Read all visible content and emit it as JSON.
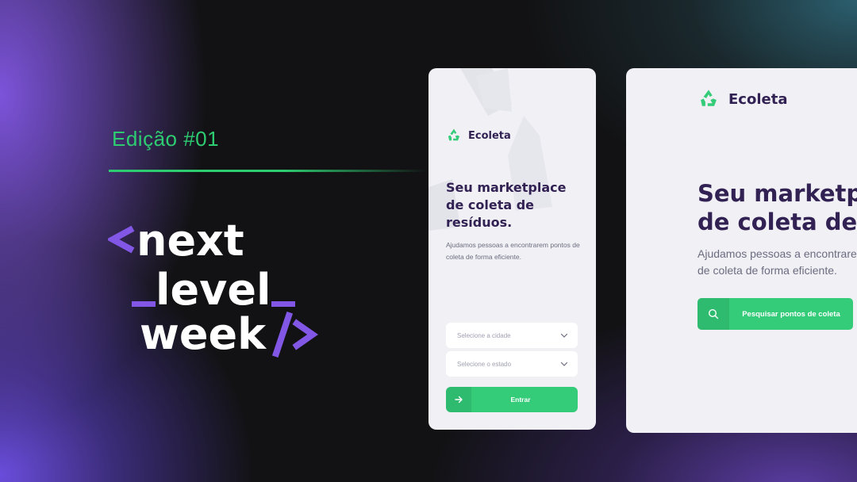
{
  "colors": {
    "background": "#121214",
    "accent_green": "#34cb79",
    "edition_green": "#2ecc71",
    "brand_purple": "#8257e5",
    "title_color": "#322153",
    "text_muted": "#6c6c80",
    "card_bg": "#f0f0f5"
  },
  "event": {
    "edition": "Edição #01",
    "logo_lines": [
      "<next",
      "_level_",
      "week/>"
    ]
  },
  "mobile": {
    "logo_icon": "recycle-icon",
    "logo_text": "Ecoleta",
    "title": "Seu marketplace de coleta de resíduos.",
    "description": "Ajudamos pessoas a encontrarem pontos de coleta de forma eficiente.",
    "city_select": "Selecione a cidade",
    "state_select": "Selecione o estado",
    "button_icon": "arrow-right-icon",
    "button_label": "Entrar"
  },
  "desktop": {
    "logo_icon": "recycle-icon",
    "logo_text": "Ecoleta",
    "title_line1": "Seu marketplace",
    "title_line2": "de coleta de resíduos.",
    "description_line1": "Ajudamos pessoas a encontrarem pontos",
    "description_line2": "de coleta de forma eficiente.",
    "button_icon": "search-icon",
    "button_label": "Pesquisar pontos de coleta"
  }
}
